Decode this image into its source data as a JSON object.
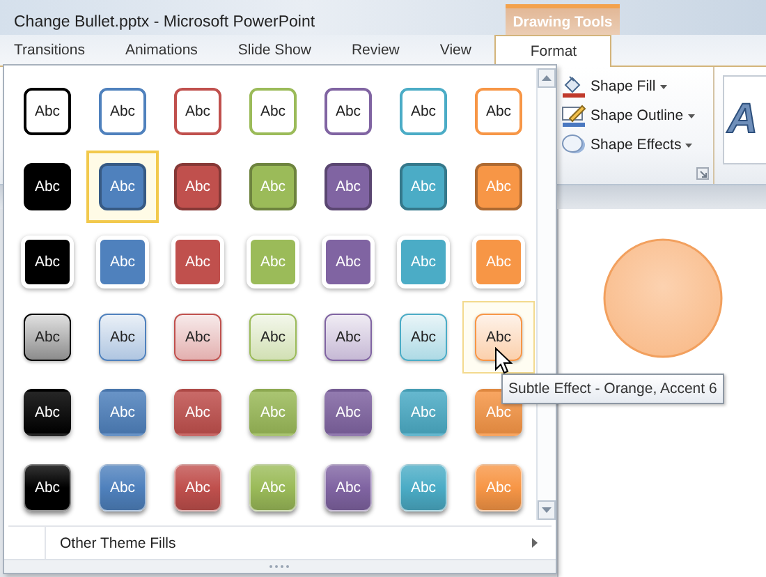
{
  "window": {
    "title": "Change Bullet.pptx  -  Microsoft PowerPoint"
  },
  "contextual_tab": {
    "label": "Drawing Tools"
  },
  "tabs": [
    {
      "label": "Transitions",
      "selected": false
    },
    {
      "label": "Animations",
      "selected": false
    },
    {
      "label": "Slide Show",
      "selected": false
    },
    {
      "label": "Review",
      "selected": false
    },
    {
      "label": "View",
      "selected": false
    },
    {
      "label": "Format",
      "selected": true
    }
  ],
  "ribbon_commands": [
    {
      "label": "Shape Fill",
      "kind": "fill"
    },
    {
      "label": "Shape Outline",
      "kind": "outline"
    },
    {
      "label": "Shape Effects",
      "kind": "effects"
    }
  ],
  "wordart_preview": {
    "label": "A"
  },
  "gallery": {
    "rows": [
      {
        "kind": "outline",
        "items": [
          {
            "label": "Abc",
            "color": "#000000",
            "selected": false,
            "hovered": false
          },
          {
            "label": "Abc",
            "color": "#4f81bd",
            "selected": false,
            "hovered": false
          },
          {
            "label": "Abc",
            "color": "#c0504d",
            "selected": false,
            "hovered": false
          },
          {
            "label": "Abc",
            "color": "#9bbb59",
            "selected": false,
            "hovered": false
          },
          {
            "label": "Abc",
            "color": "#8064a2",
            "selected": false,
            "hovered": false
          },
          {
            "label": "Abc",
            "color": "#4bacc6",
            "selected": false,
            "hovered": false
          },
          {
            "label": "Abc",
            "color": "#f79646",
            "selected": false,
            "hovered": false
          }
        ]
      },
      {
        "kind": "filled",
        "items": [
          {
            "label": "Abc",
            "color": "#000000",
            "selected": false,
            "hovered": false
          },
          {
            "label": "Abc",
            "color": "#4f81bd",
            "selected": true,
            "hovered": false
          },
          {
            "label": "Abc",
            "color": "#c0504d",
            "selected": false,
            "hovered": false
          },
          {
            "label": "Abc",
            "color": "#9bbb59",
            "selected": false,
            "hovered": false
          },
          {
            "label": "Abc",
            "color": "#8064a2",
            "selected": false,
            "hovered": false
          },
          {
            "label": "Abc",
            "color": "#4bacc6",
            "selected": false,
            "hovered": false
          },
          {
            "label": "Abc",
            "color": "#f79646",
            "selected": false,
            "hovered": false
          }
        ]
      },
      {
        "kind": "flat",
        "items": [
          {
            "label": "Abc",
            "color": "#000000",
            "selected": false,
            "hovered": false
          },
          {
            "label": "Abc",
            "color": "#4f81bd",
            "selected": false,
            "hovered": false
          },
          {
            "label": "Abc",
            "color": "#c0504d",
            "selected": false,
            "hovered": false
          },
          {
            "label": "Abc",
            "color": "#9bbb59",
            "selected": false,
            "hovered": false
          },
          {
            "label": "Abc",
            "color": "#8064a2",
            "selected": false,
            "hovered": false
          },
          {
            "label": "Abc",
            "color": "#4bacc6",
            "selected": false,
            "hovered": false
          },
          {
            "label": "Abc",
            "color": "#f79646",
            "selected": false,
            "hovered": false
          }
        ]
      },
      {
        "kind": "subtle",
        "items": [
          {
            "label": "Abc",
            "color": "#000000",
            "selected": false,
            "hovered": false
          },
          {
            "label": "Abc",
            "color": "#4f81bd",
            "selected": false,
            "hovered": false
          },
          {
            "label": "Abc",
            "color": "#c0504d",
            "selected": false,
            "hovered": false
          },
          {
            "label": "Abc",
            "color": "#9bbb59",
            "selected": false,
            "hovered": false
          },
          {
            "label": "Abc",
            "color": "#8064a2",
            "selected": false,
            "hovered": false
          },
          {
            "label": "Abc",
            "color": "#4bacc6",
            "selected": false,
            "hovered": false
          },
          {
            "label": "Abc",
            "color": "#f79646",
            "selected": false,
            "hovered": true
          }
        ]
      },
      {
        "kind": "moderate",
        "items": [
          {
            "label": "Abc",
            "color": "#000000",
            "selected": false,
            "hovered": false
          },
          {
            "label": "Abc",
            "color": "#4f81bd",
            "selected": false,
            "hovered": false
          },
          {
            "label": "Abc",
            "color": "#c0504d",
            "selected": false,
            "hovered": false
          },
          {
            "label": "Abc",
            "color": "#9bbb59",
            "selected": false,
            "hovered": false
          },
          {
            "label": "Abc",
            "color": "#8064a2",
            "selected": false,
            "hovered": false
          },
          {
            "label": "Abc",
            "color": "#4bacc6",
            "selected": false,
            "hovered": false
          },
          {
            "label": "Abc",
            "color": "#f79646",
            "selected": false,
            "hovered": false
          }
        ]
      },
      {
        "kind": "intense",
        "items": [
          {
            "label": "Abc",
            "color": "#000000",
            "selected": false,
            "hovered": false
          },
          {
            "label": "Abc",
            "color": "#4f81bd",
            "selected": false,
            "hovered": false
          },
          {
            "label": "Abc",
            "color": "#c0504d",
            "selected": false,
            "hovered": false
          },
          {
            "label": "Abc",
            "color": "#9bbb59",
            "selected": false,
            "hovered": false
          },
          {
            "label": "Abc",
            "color": "#8064a2",
            "selected": false,
            "hovered": false
          },
          {
            "label": "Abc",
            "color": "#4bacc6",
            "selected": false,
            "hovered": false
          },
          {
            "label": "Abc",
            "color": "#f79646",
            "selected": false,
            "hovered": false
          }
        ]
      }
    ],
    "footer_item": {
      "label": "Other Theme Fills"
    }
  },
  "tooltip": {
    "text": "Subtle Effect - Orange, Accent 6"
  }
}
